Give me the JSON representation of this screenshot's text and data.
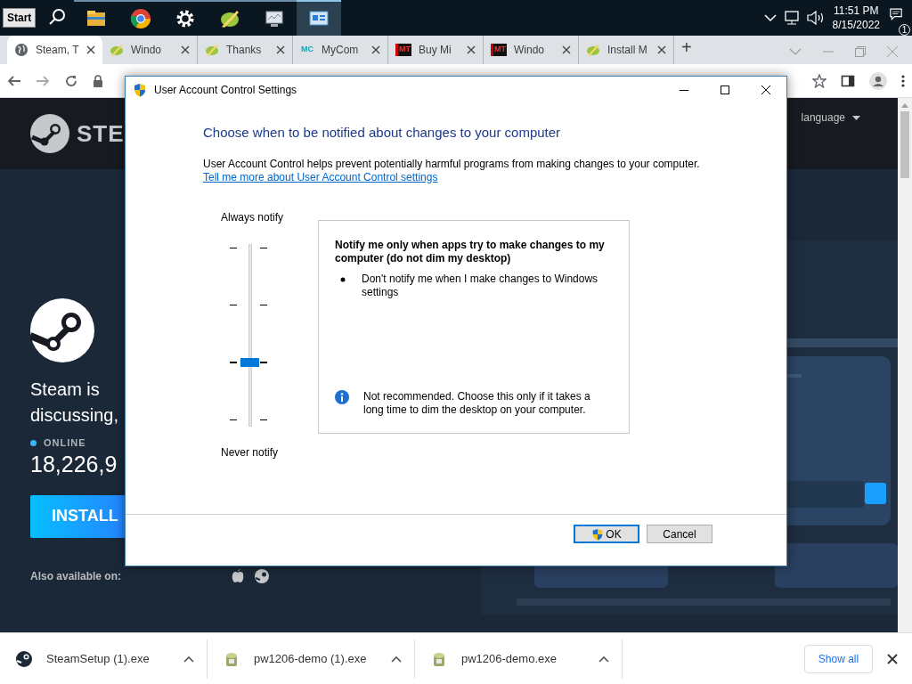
{
  "taskbar": {
    "start": "Start",
    "apps": [
      {
        "kind": "folder",
        "selected": false
      },
      {
        "kind": "chrome",
        "selected": false
      },
      {
        "kind": "gear",
        "selected": false
      },
      {
        "kind": "pen",
        "selected": false
      },
      {
        "kind": "monitor",
        "selected": false
      },
      {
        "kind": "window",
        "selected": true
      }
    ],
    "time": "11:51 PM",
    "date": "8/15/2022",
    "notifications": "1"
  },
  "browser": {
    "tabs": [
      {
        "label": "Steam, T",
        "kind": "globe",
        "selected": true
      },
      {
        "label": "Windo",
        "kind": "pen",
        "selected": false
      },
      {
        "label": "Thanks",
        "kind": "pen",
        "selected": false
      },
      {
        "label": "MyCom",
        "kind": "text",
        "icon_text": "MC",
        "selected": false
      },
      {
        "label": "Buy Mi",
        "kind": "text",
        "icon_text": "MT",
        "selected": false
      },
      {
        "label": "Windo",
        "kind": "text",
        "icon_text": "MT",
        "selected": false
      },
      {
        "label": "Install M",
        "kind": "pen",
        "selected": false
      }
    ],
    "new_tab": "+"
  },
  "page": {
    "logo_text": "STE",
    "tagline": [
      "Steam is",
      "discussing,"
    ],
    "online_label": "ONLINE",
    "online_count": "18,226,9",
    "install": "INSTALL",
    "also_available": "Also available on:",
    "language": "language"
  },
  "dialog": {
    "title": "User Account Control Settings",
    "heading": "Choose when to be notified about changes to your computer",
    "description": "User Account Control helps prevent potentially harmful programs from making changes to your computer.",
    "link": "Tell me more about User Account Control settings",
    "slider": {
      "top_label": "Always notify",
      "bottom_label": "Never notify",
      "level": 0.333
    },
    "info": {
      "title": "Notify me only when apps try to make changes to my computer (do not dim my desktop)",
      "bullets": [
        "Don't notify me when I make changes to Windows settings"
      ],
      "note": "Not recommended. Choose this only if it takes a long time to dim the desktop on your computer."
    },
    "buttons": [
      {
        "label": "OK",
        "default": true,
        "shield": true
      },
      {
        "label": "Cancel",
        "default": false,
        "shield": false
      }
    ]
  },
  "downloads": {
    "items": [
      {
        "name": "SteamSetup (1).exe",
        "kind": "steam"
      },
      {
        "name": "pw1206-demo (1).exe",
        "kind": "installer"
      },
      {
        "name": "pw1206-demo.exe",
        "kind": "installer"
      }
    ],
    "show_all": "Show all"
  }
}
